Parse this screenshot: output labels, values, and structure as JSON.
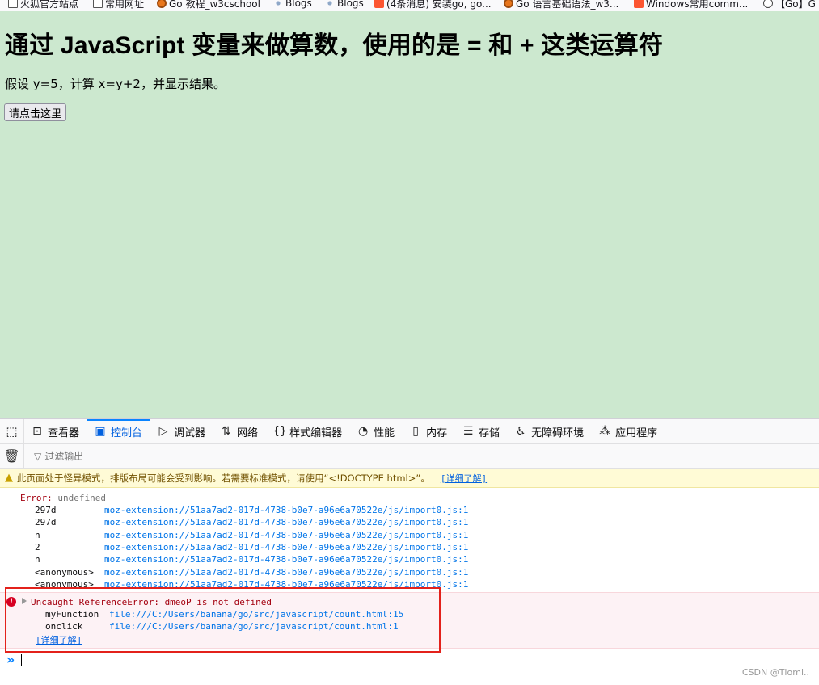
{
  "bookmarks": [
    {
      "label": "火狐官方站点",
      "icon": "folder-icon"
    },
    {
      "label": "常用网址",
      "icon": "folder-icon"
    },
    {
      "label": "Go 教程_w3cschool",
      "icon": "w3cschool-icon"
    },
    {
      "label": "Blogs",
      "icon": "blogs-icon"
    },
    {
      "label": "Blogs",
      "icon": "blogs-icon"
    },
    {
      "label": "(4条消息) 安装go, go...",
      "icon": "csdn-icon"
    },
    {
      "label": "Go 语言基础语法_w3...",
      "icon": "w3cschool-icon"
    },
    {
      "label": "Windows常用comm...",
      "icon": "csdn-icon"
    },
    {
      "label": "【Go】G",
      "icon": "globe-icon"
    }
  ],
  "page": {
    "heading": "通过 JavaScript 变量来做算数，使用的是 = 和 + 这类运算符",
    "paragraph": "假设 y=5，计算 x=y+2，并显示结果。",
    "button_label": "请点击这里",
    "background_color": "#cce8cf"
  },
  "devtools": {
    "tabs": [
      {
        "label": "查看器",
        "icon": "inspector-icon",
        "active": false
      },
      {
        "label": "控制台",
        "icon": "console-icon",
        "active": true
      },
      {
        "label": "调试器",
        "icon": "debugger-icon",
        "active": false
      },
      {
        "label": "网络",
        "icon": "network-icon",
        "active": false
      },
      {
        "label": "样式编辑器",
        "icon": "style-editor-icon",
        "active": false
      },
      {
        "label": "性能",
        "icon": "performance-icon",
        "active": false
      },
      {
        "label": "内存",
        "icon": "memory-icon",
        "active": false
      },
      {
        "label": "存储",
        "icon": "storage-icon",
        "active": false
      },
      {
        "label": "无障碍环境",
        "icon": "accessibility-icon",
        "active": false
      },
      {
        "label": "应用程序",
        "icon": "application-icon",
        "active": false
      }
    ],
    "filter_placeholder": "过滤输出",
    "accent_color": "#0a84ff"
  },
  "console": {
    "warning": {
      "text": "此页面处于怪异模式，排版布局可能会受到影响。若需要标准模式，请使用“<!DOCTYPE html>”。",
      "link": "[详细了解]"
    },
    "error1": {
      "label": "Error:",
      "value": "undefined",
      "stack": [
        {
          "fn": "297d",
          "src": "moz-extension://51aa7ad2-017d-4738-b0e7-a96e6a70522e/js/import0.js:1"
        },
        {
          "fn": "297d",
          "src": "moz-extension://51aa7ad2-017d-4738-b0e7-a96e6a70522e/js/import0.js:1"
        },
        {
          "fn": "n",
          "src": "moz-extension://51aa7ad2-017d-4738-b0e7-a96e6a70522e/js/import0.js:1"
        },
        {
          "fn": "2",
          "src": "moz-extension://51aa7ad2-017d-4738-b0e7-a96e6a70522e/js/import0.js:1"
        },
        {
          "fn": "n",
          "src": "moz-extension://51aa7ad2-017d-4738-b0e7-a96e6a70522e/js/import0.js:1"
        },
        {
          "fn": "<anonymous>",
          "src": "moz-extension://51aa7ad2-017d-4738-b0e7-a96e6a70522e/js/import0.js:1"
        },
        {
          "fn": "<anonymous>",
          "src": "moz-extension://51aa7ad2-017d-4738-b0e7-a96e6a70522e/js/import0.js:1"
        }
      ]
    },
    "error2": {
      "message": "Uncaught ReferenceError: dmeoP is not defined",
      "stack": [
        {
          "fn": "myFunction",
          "src": "file:///C:/Users/banana/go/src/javascript/count.html:15"
        },
        {
          "fn": "onclick",
          "src": "file:///C:/Users/banana/go/src/javascript/count.html:1"
        }
      ],
      "learn_more": "[详细了解]"
    },
    "prompt": "»"
  },
  "watermark": "CSDN @Tloml.."
}
